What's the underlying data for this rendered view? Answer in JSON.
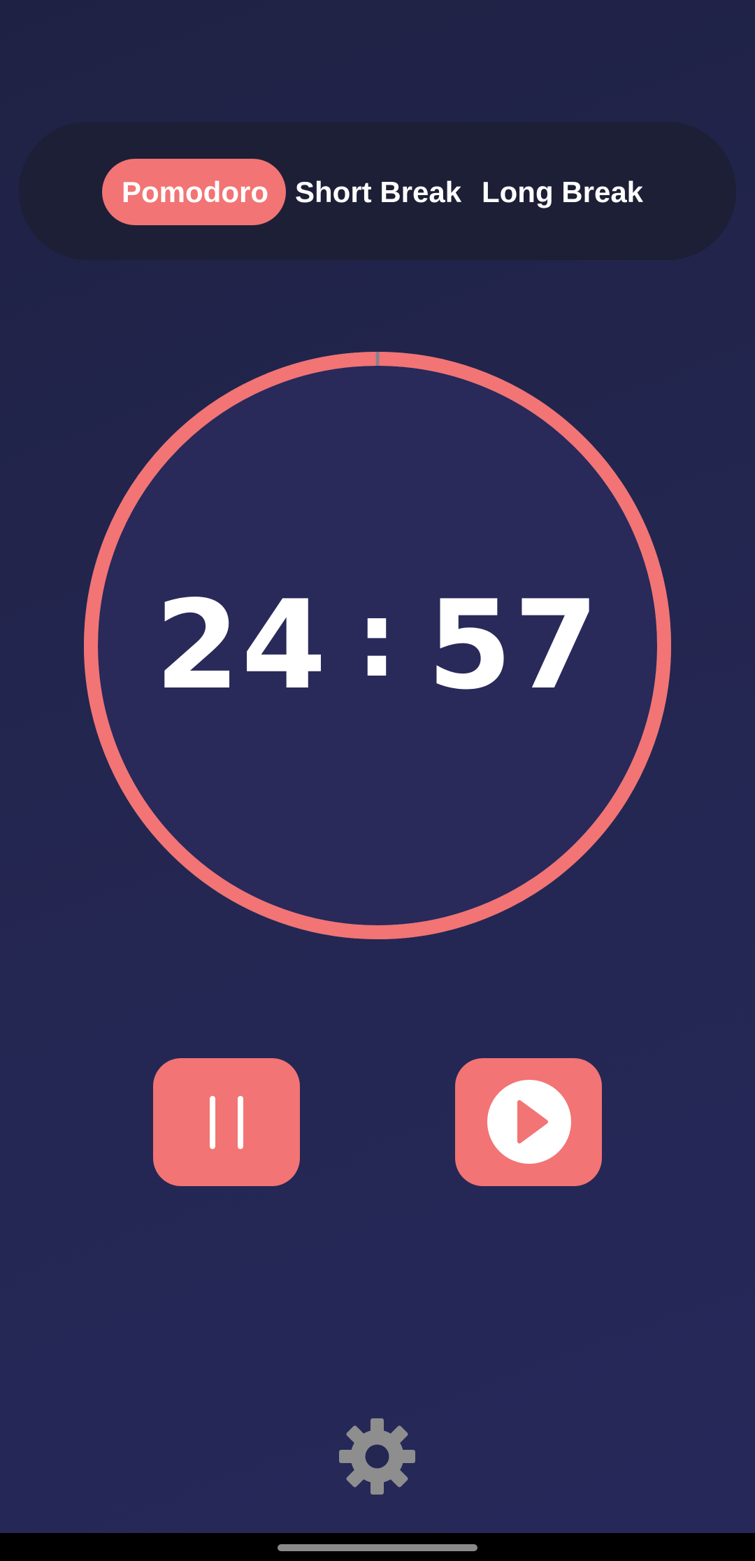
{
  "theme": {
    "background": "#222450",
    "mode_bar_bg": "#1d1f36",
    "accent": "#f27474",
    "text": "#ffffff",
    "settings_icon_color": "#8e8e8e"
  },
  "modes": {
    "active": "Pomodoro",
    "tabs": [
      {
        "label": "Pomodoro"
      },
      {
        "label": "Short Break"
      },
      {
        "label": "Long Break"
      }
    ]
  },
  "timer": {
    "minutes": "24",
    "separator": ":",
    "seconds": "57",
    "progress_remaining": 0.998
  },
  "controls": {
    "pause_icon": "pause-icon",
    "play_icon": "play-icon"
  },
  "settings": {
    "icon": "gear-icon"
  }
}
